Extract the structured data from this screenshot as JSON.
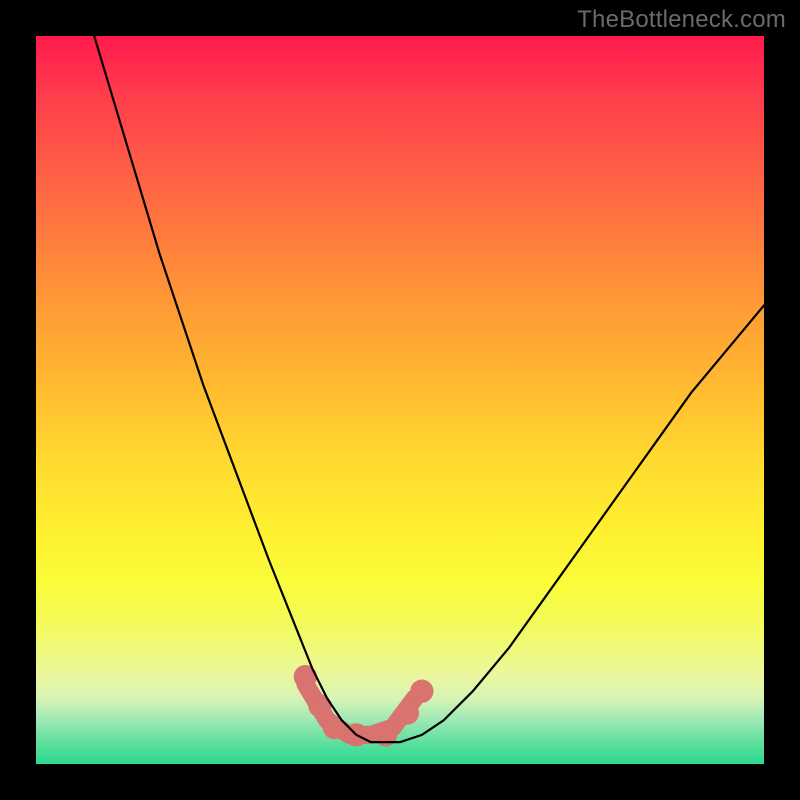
{
  "watermark": "TheBottleneck.com",
  "colors": {
    "background": "#000000",
    "gradient_top": "#ff1a4d",
    "gradient_bottom": "#2bd98e",
    "curve": "#000000",
    "accent_band": "#d8736f",
    "watermark_text": "#6a6a6a"
  },
  "chart_data": {
    "type": "line",
    "title": "",
    "xlabel": "",
    "ylabel": "",
    "xlim": [
      0,
      100
    ],
    "ylim": [
      0,
      100
    ],
    "grid": false,
    "legend": null,
    "series": [
      {
        "name": "bottleneck-curve",
        "x": [
          8,
          11,
          14,
          17,
          20,
          23,
          26,
          29,
          32,
          34,
          36,
          38,
          40,
          42,
          44,
          46,
          48,
          50,
          53,
          56,
          60,
          65,
          70,
          75,
          80,
          85,
          90,
          95,
          100
        ],
        "y": [
          100,
          90,
          80,
          70,
          61,
          52,
          44,
          36,
          28,
          23,
          18,
          13,
          9,
          6,
          4,
          3,
          3,
          3,
          4,
          6,
          10,
          16,
          23,
          30,
          37,
          44,
          51,
          57,
          63
        ]
      }
    ],
    "accent_band": {
      "name": "optimal-zone",
      "x": [
        37,
        40,
        43,
        46,
        49,
        52
      ],
      "y": [
        11,
        6,
        4,
        4,
        5,
        9
      ]
    },
    "accent_dots": {
      "name": "optimal-markers",
      "points": [
        {
          "x": 37,
          "y": 12
        },
        {
          "x": 39,
          "y": 8
        },
        {
          "x": 41,
          "y": 5
        },
        {
          "x": 44,
          "y": 4
        },
        {
          "x": 48,
          "y": 4
        },
        {
          "x": 51,
          "y": 7
        },
        {
          "x": 53,
          "y": 10
        }
      ]
    }
  }
}
